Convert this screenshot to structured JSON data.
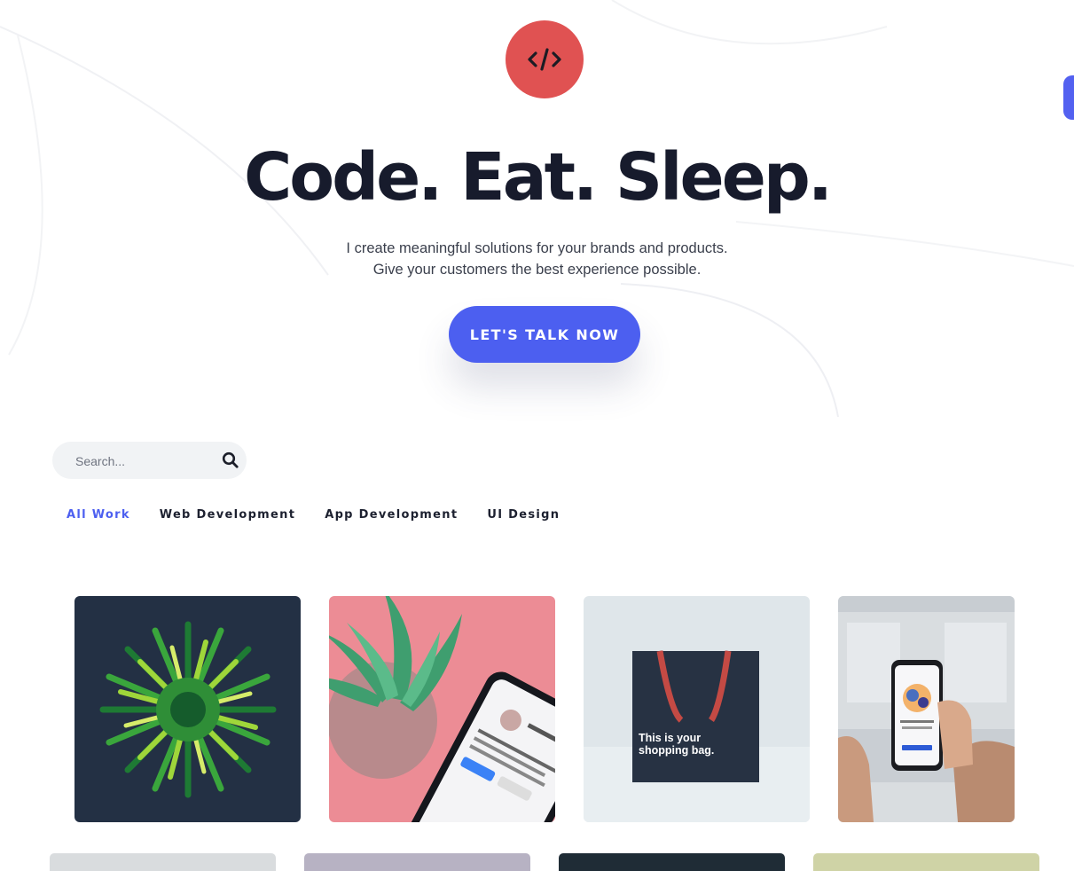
{
  "hero": {
    "title": "Code. Eat. Sleep.",
    "subtitle_line1": "I create meaningful solutions for your brands and products.",
    "subtitle_line2": "Give your customers the best experience possible.",
    "cta_label": "LET'S TALK NOW"
  },
  "logo": {
    "icon": "code-icon",
    "color": "#e05252"
  },
  "search": {
    "placeholder": "Search...",
    "icon": "search-icon"
  },
  "filters": [
    {
      "label": "All Work",
      "active": true
    },
    {
      "label": "Web Development",
      "active": false
    },
    {
      "label": "App Development",
      "active": false
    },
    {
      "label": "UI Design",
      "active": false
    }
  ],
  "portfolio": {
    "items": [
      {
        "image": "green-straws-burst"
      },
      {
        "image": "succulent-and-phone-on-pink"
      },
      {
        "image": "navy-shopping-bag",
        "caption_line1": "This is your",
        "caption_line2": "shopping bag."
      },
      {
        "image": "hands-holding-phone-app"
      }
    ]
  },
  "colors": {
    "accent": "#4c5ff0",
    "brand": "#e05252",
    "text": "#171b2c"
  }
}
